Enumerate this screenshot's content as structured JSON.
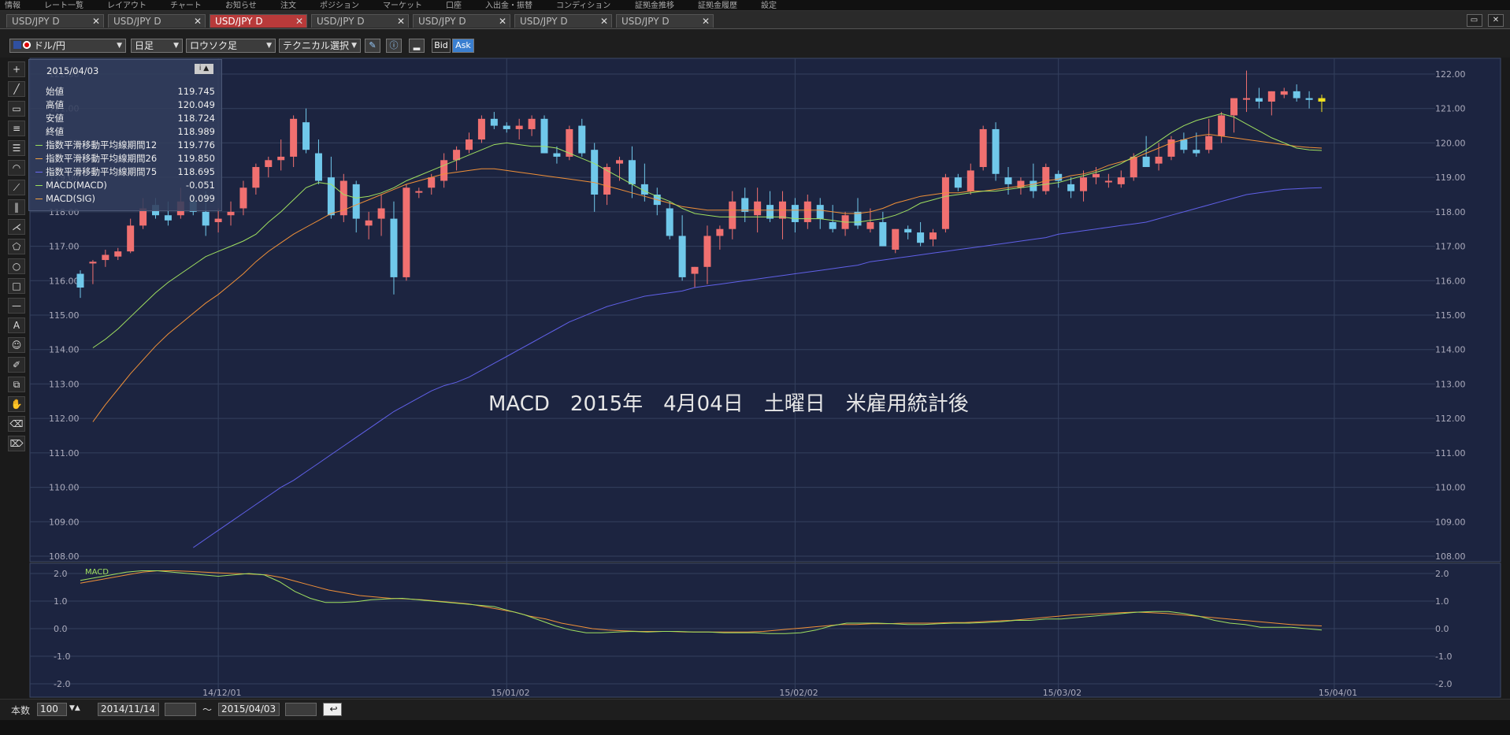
{
  "topbar": {
    "items": [
      "情報",
      "レート一覧",
      "レイアウト",
      "チャート",
      "お知らせ",
      "注文",
      "ポジション",
      "マーケット",
      "口座",
      "入出金・振替",
      "コンディション",
      "証拠金推移",
      "証拠金履歴",
      "設定"
    ]
  },
  "tabs": [
    {
      "label": "USD/JPY D",
      "active": false
    },
    {
      "label": "USD/JPY D",
      "active": false
    },
    {
      "label": "USD/JPY D",
      "active": true
    },
    {
      "label": "USD/JPY D",
      "active": false
    },
    {
      "label": "USD/JPY D",
      "active": false
    },
    {
      "label": "USD/JPY D",
      "active": false
    },
    {
      "label": "USD/JPY D",
      "active": false
    }
  ],
  "toolbar": {
    "currency": "ドル/円",
    "period": "日足",
    "chart_type": "ロウソク足",
    "technical": "テクニカル選択",
    "bid": "Bid",
    "ask": "Ask"
  },
  "info": {
    "date": "2015/04/03",
    "rows": [
      {
        "label": "始値",
        "value": "119.745",
        "color": ""
      },
      {
        "label": "高値",
        "value": "120.049",
        "color": ""
      },
      {
        "label": "安値",
        "value": "118.724",
        "color": ""
      },
      {
        "label": "終値",
        "value": "118.989",
        "color": ""
      },
      {
        "label": "指数平滑移動平均線期間12",
        "value": "119.776",
        "color": "#9be05a"
      },
      {
        "label": "指数平滑移動平均線期間26",
        "value": "119.850",
        "color": "#f0a040"
      },
      {
        "label": "指数平滑移動平均線期間75",
        "value": "118.695",
        "color": "#6a6af0"
      },
      {
        "label": "MACD(MACD)",
        "value": "-0.051",
        "color": "#9be05a"
      },
      {
        "label": "MACD(SIG)",
        "value": "0.099",
        "color": "#f0a040"
      }
    ]
  },
  "annotation": "MACD　2015年　4月04日　土曜日　米雇用統計後",
  "bottom": {
    "count_label": "本数",
    "count": "100",
    "from": "2014/11/14",
    "tilde": "〜",
    "to": "2015/04/03"
  },
  "chart_data": {
    "type": "candlestick",
    "ylim": [
      108,
      122.3
    ],
    "yticks": [
      "122.00",
      "121.00",
      "120.00",
      "119.00",
      "118.00",
      "117.00",
      "116.00",
      "115.00",
      "114.00",
      "113.00",
      "112.00",
      "111.00",
      "110.00",
      "109.00",
      "108.00"
    ],
    "xticks": [
      {
        "label": "14/12/01",
        "index": 11
      },
      {
        "label": "15/01/02",
        "index": 34
      },
      {
        "label": "15/02/02",
        "index": 57
      },
      {
        "label": "15/03/02",
        "index": 78
      },
      {
        "label": "15/04/01",
        "index": 100
      }
    ],
    "candles": [
      [
        116.2,
        116.3,
        115.5,
        115.8
      ],
      [
        116.5,
        116.6,
        115.9,
        116.55
      ],
      [
        116.6,
        116.9,
        116.4,
        116.75
      ],
      [
        116.7,
        116.95,
        116.6,
        116.85
      ],
      [
        116.85,
        117.8,
        116.8,
        117.6
      ],
      [
        117.6,
        118.4,
        117.5,
        118.1
      ],
      [
        118.2,
        118.4,
        117.8,
        117.9
      ],
      [
        117.9,
        118.3,
        117.6,
        117.75
      ],
      [
        117.9,
        118.7,
        117.8,
        118.3
      ],
      [
        118.3,
        118.5,
        117.9,
        118.0
      ],
      [
        118.0,
        118.6,
        117.3,
        117.6
      ],
      [
        117.7,
        118.1,
        117.4,
        117.8
      ],
      [
        117.9,
        118.3,
        117.6,
        118.0
      ],
      [
        118.1,
        118.9,
        117.9,
        118.7
      ],
      [
        118.7,
        119.4,
        118.5,
        119.3
      ],
      [
        119.3,
        119.6,
        119.0,
        119.5
      ],
      [
        119.5,
        120.1,
        119.2,
        119.6
      ],
      [
        119.6,
        120.8,
        119.3,
        120.7
      ],
      [
        120.6,
        121.0,
        119.7,
        119.8
      ],
      [
        119.7,
        120.1,
        118.8,
        118.9
      ],
      [
        119.0,
        119.6,
        117.8,
        117.9
      ],
      [
        117.9,
        119.1,
        117.7,
        118.9
      ],
      [
        118.8,
        118.9,
        117.4,
        117.8
      ],
      [
        117.6,
        118.0,
        117.2,
        117.75
      ],
      [
        117.8,
        118.5,
        117.3,
        118.1
      ],
      [
        117.8,
        118.3,
        115.6,
        116.1
      ],
      [
        116.1,
        118.8,
        116.0,
        118.7
      ],
      [
        118.6,
        118.7,
        118.4,
        118.6
      ],
      [
        118.7,
        119.1,
        118.5,
        119.0
      ],
      [
        118.9,
        119.7,
        118.7,
        119.5
      ],
      [
        119.5,
        119.9,
        119.2,
        119.8
      ],
      [
        119.8,
        120.3,
        119.7,
        120.1
      ],
      [
        120.1,
        120.8,
        120.0,
        120.7
      ],
      [
        120.7,
        120.9,
        120.4,
        120.5
      ],
      [
        120.5,
        120.6,
        120.3,
        120.4
      ],
      [
        120.4,
        120.7,
        120.1,
        120.5
      ],
      [
        120.4,
        120.8,
        120.2,
        120.7
      ],
      [
        120.7,
        120.8,
        119.7,
        119.7
      ],
      [
        119.7,
        119.9,
        119.4,
        119.6
      ],
      [
        119.6,
        120.5,
        119.5,
        120.4
      ],
      [
        120.5,
        120.7,
        119.6,
        119.7
      ],
      [
        119.8,
        120.0,
        118.0,
        118.5
      ],
      [
        118.5,
        119.4,
        118.2,
        119.3
      ],
      [
        119.4,
        119.6,
        118.9,
        119.5
      ],
      [
        119.5,
        119.9,
        118.4,
        118.8
      ],
      [
        118.8,
        119.4,
        118.3,
        118.5
      ],
      [
        118.5,
        118.7,
        117.9,
        118.2
      ],
      [
        118.1,
        118.3,
        117.2,
        117.3
      ],
      [
        117.3,
        117.9,
        116.0,
        116.1
      ],
      [
        116.2,
        116.4,
        115.8,
        116.4
      ],
      [
        116.4,
        117.6,
        115.9,
        117.3
      ],
      [
        117.3,
        117.6,
        116.9,
        117.5
      ],
      [
        117.5,
        118.6,
        117.2,
        118.3
      ],
      [
        118.4,
        118.7,
        117.7,
        118.0
      ],
      [
        117.9,
        118.7,
        117.4,
        118.3
      ],
      [
        118.2,
        118.6,
        117.7,
        117.8
      ],
      [
        117.8,
        118.6,
        117.2,
        118.3
      ],
      [
        118.2,
        118.4,
        117.4,
        117.7
      ],
      [
        117.7,
        118.5,
        117.5,
        118.3
      ],
      [
        118.2,
        118.4,
        117.5,
        117.8
      ],
      [
        117.7,
        118.2,
        117.4,
        117.5
      ],
      [
        117.5,
        118.0,
        117.3,
        117.9
      ],
      [
        118.0,
        118.4,
        117.5,
        117.6
      ],
      [
        117.5,
        118.1,
        117.4,
        117.7
      ],
      [
        117.7,
        118.0,
        117.0,
        117.0
      ],
      [
        116.9,
        117.5,
        116.8,
        117.5
      ],
      [
        117.5,
        117.6,
        117.2,
        117.4
      ],
      [
        117.4,
        117.7,
        117.0,
        117.1
      ],
      [
        117.2,
        117.5,
        117.0,
        117.4
      ],
      [
        117.5,
        119.1,
        117.4,
        119.0
      ],
      [
        119.0,
        119.1,
        118.6,
        118.7
      ],
      [
        118.6,
        119.4,
        118.5,
        119.2
      ],
      [
        119.3,
        120.5,
        119.2,
        120.4
      ],
      [
        120.4,
        120.6,
        118.9,
        119.1
      ],
      [
        119.0,
        119.3,
        118.5,
        118.8
      ],
      [
        118.7,
        119.0,
        118.5,
        118.9
      ],
      [
        118.9,
        119.4,
        118.4,
        118.6
      ],
      [
        118.6,
        119.4,
        118.5,
        119.3
      ],
      [
        119.1,
        119.2,
        118.7,
        118.9
      ],
      [
        118.8,
        119.0,
        118.4,
        118.6
      ],
      [
        118.6,
        119.2,
        118.3,
        119.0
      ],
      [
        119.0,
        119.3,
        118.8,
        119.1
      ],
      [
        118.9,
        119.1,
        118.7,
        118.9
      ],
      [
        118.8,
        119.2,
        118.7,
        119.0
      ],
      [
        119.0,
        119.7,
        118.9,
        119.6
      ],
      [
        119.6,
        120.2,
        119.4,
        119.3
      ],
      [
        119.4,
        120.0,
        119.2,
        119.6
      ],
      [
        119.6,
        120.2,
        119.5,
        120.1
      ],
      [
        120.1,
        120.3,
        119.7,
        119.8
      ],
      [
        119.8,
        120.3,
        119.6,
        119.7
      ],
      [
        119.8,
        120.7,
        119.7,
        120.2
      ],
      [
        120.2,
        120.9,
        120.0,
        120.8
      ],
      [
        120.8,
        121.2,
        120.3,
        121.3
      ],
      [
        121.3,
        122.1,
        120.9,
        121.3
      ],
      [
        121.3,
        121.6,
        121.0,
        121.2
      ],
      [
        121.2,
        121.5,
        120.8,
        121.5
      ],
      [
        121.4,
        121.6,
        121.3,
        121.5
      ],
      [
        121.5,
        121.7,
        121.2,
        121.3
      ],
      [
        121.3,
        121.5,
        121.0,
        121.25
      ],
      [
        121.3,
        121.4,
        120.9,
        121.2
      ]
    ],
    "ema12": [
      114.05,
      114.3,
      114.6,
      114.95,
      115.3,
      115.65,
      115.95,
      116.2,
      116.45,
      116.7,
      116.85,
      117.0,
      117.15,
      117.35,
      117.7,
      118.0,
      118.35,
      118.7,
      118.85,
      118.8,
      118.5,
      118.4,
      118.45,
      118.55,
      118.7,
      118.9,
      119.05,
      119.2,
      119.35,
      119.5,
      119.65,
      119.8,
      119.95,
      120.0,
      119.95,
      119.9,
      119.9,
      119.85,
      119.7,
      119.55,
      119.4,
      119.2,
      119.0,
      118.8,
      118.6,
      118.45,
      118.3,
      118.1,
      117.95,
      117.9,
      117.85,
      117.85,
      117.85,
      117.85,
      117.85,
      117.85,
      117.8,
      117.8,
      117.8,
      117.75,
      117.7,
      117.7,
      117.75,
      117.8,
      117.9,
      118.05,
      118.25,
      118.35,
      118.45,
      118.5,
      118.55,
      118.6,
      118.6,
      118.65,
      118.7,
      118.75,
      118.8,
      118.85,
      118.95,
      119.05,
      119.15,
      119.25,
      119.4,
      119.6,
      119.8,
      120.05,
      120.3,
      120.5,
      120.65,
      120.75,
      120.85,
      120.75,
      120.55,
      120.35,
      120.15,
      120.0,
      119.85,
      119.8,
      119.78
    ],
    "ema26": [
      111.9,
      112.4,
      112.85,
      113.3,
      113.7,
      114.1,
      114.45,
      114.75,
      115.05,
      115.35,
      115.6,
      115.9,
      116.2,
      116.55,
      116.85,
      117.1,
      117.35,
      117.55,
      117.75,
      117.95,
      118.05,
      118.2,
      118.35,
      118.5,
      118.65,
      118.8,
      118.9,
      119.0,
      119.1,
      119.15,
      119.2,
      119.25,
      119.25,
      119.2,
      119.15,
      119.1,
      119.05,
      119.0,
      118.95,
      118.9,
      118.85,
      118.75,
      118.65,
      118.55,
      118.45,
      118.35,
      118.25,
      118.15,
      118.1,
      118.05,
      118.05,
      118.05,
      118.05,
      118.05,
      118.05,
      118.05,
      118.05,
      118.05,
      118.05,
      118.0,
      117.95,
      117.95,
      118.0,
      118.1,
      118.25,
      118.35,
      118.45,
      118.5,
      118.55,
      118.55,
      118.6,
      118.6,
      118.65,
      118.7,
      118.75,
      118.8,
      118.9,
      118.95,
      119.05,
      119.1,
      119.2,
      119.35,
      119.45,
      119.55,
      119.7,
      119.85,
      120.0,
      120.1,
      120.2,
      120.25,
      120.2,
      120.15,
      120.1,
      120.05,
      120.0,
      119.95,
      119.9,
      119.87,
      119.85
    ],
    "ema75": [
      108.25,
      108.5,
      108.75,
      109.0,
      109.25,
      109.5,
      109.75,
      110.0,
      110.2,
      110.45,
      110.7,
      110.95,
      111.2,
      111.45,
      111.7,
      111.95,
      112.2,
      112.4,
      112.6,
      112.8,
      112.95,
      113.05,
      113.2,
      113.4,
      113.6,
      113.8,
      114.0,
      114.2,
      114.4,
      114.6,
      114.8,
      114.95,
      115.1,
      115.25,
      115.35,
      115.45,
      115.55,
      115.6,
      115.65,
      115.7,
      115.8,
      115.85,
      115.9,
      115.95,
      116.0,
      116.05,
      116.1,
      116.15,
      116.2,
      116.25,
      116.3,
      116.35,
      116.4,
      116.45,
      116.55,
      116.6,
      116.65,
      116.7,
      116.75,
      116.8,
      116.85,
      116.9,
      116.95,
      117.0,
      117.05,
      117.1,
      117.15,
      117.2,
      117.25,
      117.35,
      117.4,
      117.45,
      117.5,
      117.55,
      117.6,
      117.65,
      117.7,
      117.8,
      117.9,
      118.0,
      118.1,
      118.2,
      118.3,
      118.4,
      118.5,
      118.55,
      118.6,
      118.65,
      118.67,
      118.69,
      118.7
    ],
    "macd_ylim": [
      -2.2,
      2.2
    ],
    "macd_yticks": [
      "2.0",
      "1.0",
      "0.0",
      "-1.0",
      "-2.0"
    ],
    "macd": [
      1.75,
      1.85,
      1.95,
      2.05,
      2.1,
      2.1,
      2.05,
      2.0,
      1.95,
      1.9,
      1.95,
      2.0,
      1.95,
      1.7,
      1.35,
      1.1,
      0.95,
      0.95,
      0.98,
      1.05,
      1.08,
      1.1,
      1.05,
      1.0,
      0.95,
      0.9,
      0.85,
      0.8,
      0.65,
      0.5,
      0.3,
      0.1,
      -0.05,
      -0.15,
      -0.15,
      -0.12,
      -0.1,
      -0.12,
      -0.1,
      -0.1,
      -0.12,
      -0.12,
      -0.15,
      -0.15,
      -0.15,
      -0.18,
      -0.18,
      -0.15,
      -0.05,
      0.1,
      0.2,
      0.2,
      0.2,
      0.18,
      0.15,
      0.15,
      0.18,
      0.2,
      0.2,
      0.22,
      0.25,
      0.3,
      0.3,
      0.35,
      0.35,
      0.4,
      0.45,
      0.5,
      0.55,
      0.6,
      0.62,
      0.62,
      0.55,
      0.45,
      0.3,
      0.2,
      0.15,
      0.05,
      0.05,
      0.05,
      0.0,
      -0.05
    ],
    "signal": [
      1.65,
      1.75,
      1.85,
      1.95,
      2.05,
      2.1,
      2.1,
      2.08,
      2.05,
      2.02,
      2.0,
      1.98,
      1.95,
      1.85,
      1.7,
      1.55,
      1.4,
      1.3,
      1.2,
      1.15,
      1.1,
      1.08,
      1.05,
      1.0,
      0.95,
      0.9,
      0.8,
      0.7,
      0.6,
      0.45,
      0.35,
      0.2,
      0.1,
      0.0,
      -0.05,
      -0.08,
      -0.1,
      -0.1,
      -0.1,
      -0.12,
      -0.12,
      -0.12,
      -0.12,
      -0.12,
      -0.1,
      -0.05,
      0.0,
      0.05,
      0.1,
      0.15,
      0.15,
      0.18,
      0.18,
      0.2,
      0.2,
      0.2,
      0.22,
      0.22,
      0.25,
      0.28,
      0.3,
      0.35,
      0.4,
      0.45,
      0.5,
      0.52,
      0.55,
      0.58,
      0.6,
      0.58,
      0.55,
      0.5,
      0.45,
      0.4,
      0.35,
      0.3,
      0.25,
      0.2,
      0.15,
      0.12,
      0.1
    ],
    "series_labels": {
      "macd": "MACD"
    }
  }
}
